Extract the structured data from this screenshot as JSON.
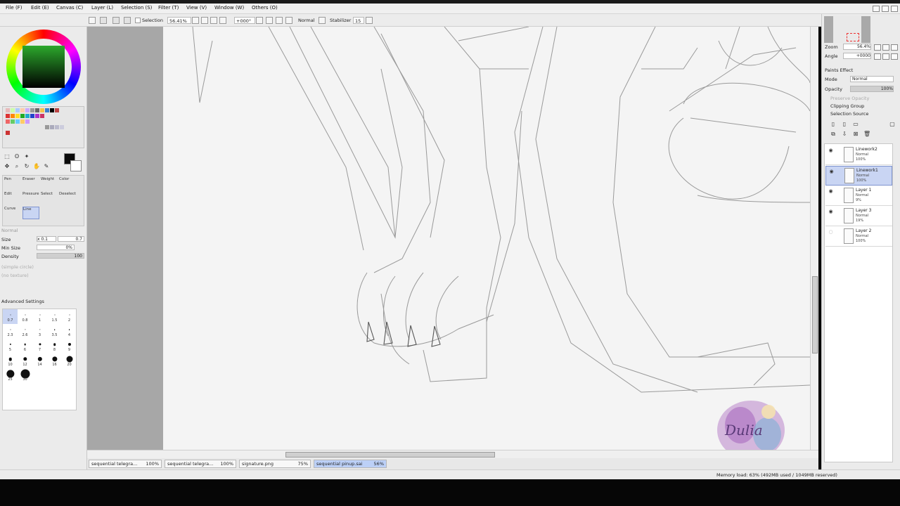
{
  "menu": {
    "items": [
      "File (F)",
      "Edit (E)",
      "Canvas (C)",
      "Layer (L)",
      "Selection (S)",
      "Filter (T)",
      "View (V)",
      "Window (W)",
      "Others (O)"
    ]
  },
  "toolbar": {
    "selection_label": "Selection",
    "zoom_value": "56.41%",
    "rotation_value": "+000°",
    "blend_mode": "Normal",
    "stabilizer_label": "Stabilizer",
    "stabilizer_value": "15"
  },
  "tools": {
    "brush_names": [
      "Pen",
      "Eraser",
      "Weight",
      "Color",
      "Edit",
      "Pressure",
      "Select",
      "Deselect",
      "Curve",
      "Line"
    ],
    "mode": "Normal",
    "size_label": "Size",
    "size_multiplier": "x 0.1",
    "size_value": "0.7",
    "min_size_label": "Min Size",
    "min_size_value": "0%",
    "density_label": "Density",
    "density_value": "100",
    "texture_1": "(simple circle)",
    "texture_2": "(no texture)",
    "advanced_settings": "Advanced Settings",
    "brush_sizes": [
      "0.7",
      "0.8",
      "1",
      "1.5",
      "2",
      "2.3",
      "2.6",
      "3",
      "3.5",
      "4",
      "5",
      "6",
      "7",
      "8",
      "9",
      "10",
      "12",
      "14",
      "16",
      "20",
      "25",
      "30"
    ]
  },
  "right_panel": {
    "zoom_label": "Zoom",
    "zoom_value": "56.4%",
    "angle_label": "Angle",
    "angle_value": "+0000",
    "paints_effect": "Paints Effect",
    "mode_label": "Mode",
    "mode_value": "Normal",
    "opacity_label": "Opacity",
    "opacity_value": "100%",
    "preserve_opacity": "Preserve Opacity",
    "clipping_group": "Clipping Group",
    "selection_source": "Selection Source",
    "layers": [
      {
        "name": "Linework2",
        "mode": "Normal",
        "opacity": "100%",
        "active": false
      },
      {
        "name": "Linework1",
        "mode": "Normal",
        "opacity": "100%",
        "active": true
      },
      {
        "name": "Layer 1",
        "mode": "Normal",
        "opacity": "9%",
        "active": false
      },
      {
        "name": "Layer 3",
        "mode": "Normal",
        "opacity": "19%",
        "active": false
      },
      {
        "name": "Layer 2",
        "mode": "Normal",
        "opacity": "100%",
        "active": false
      }
    ]
  },
  "file_tabs": [
    {
      "name": "sequential telegra...",
      "zoom": "100%",
      "active": false
    },
    {
      "name": "sequential telegra...",
      "zoom": "100%",
      "active": false
    },
    {
      "name": "signature.png",
      "zoom": "75%",
      "active": false
    },
    {
      "name": "sequential pinup.sai",
      "zoom": "56%",
      "active": true
    }
  ],
  "status": {
    "memory": "Memory load: 63% (492MB used / 1049MB reserved)"
  },
  "watermark_text": "Dulia",
  "colors": {
    "accent_selected": "#bcd0f7",
    "foreground": "#0a0a0a",
    "background": "#ffffff",
    "canvas_bg": "#a7a7a7"
  }
}
